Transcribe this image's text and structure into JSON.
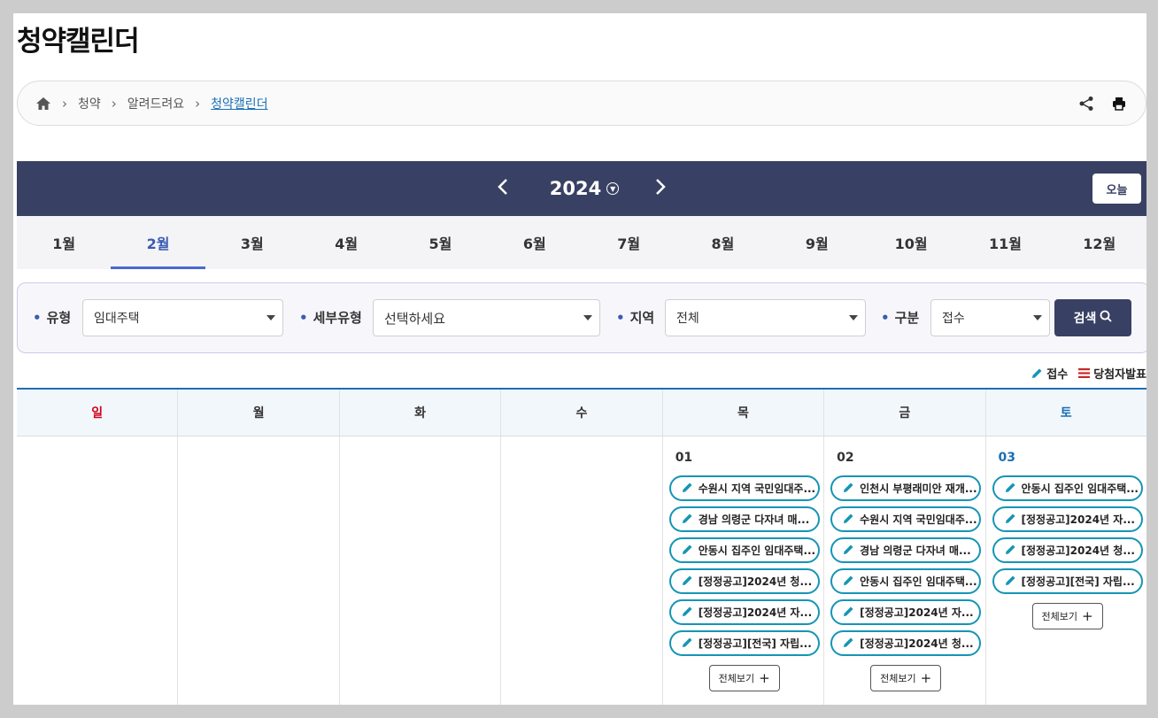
{
  "page_title": "청약캘린더",
  "breadcrumb": {
    "items": [
      "청약",
      "알려드려요"
    ],
    "current": "청약캘린더"
  },
  "year_nav": {
    "year": "2024",
    "today_label": "오늘"
  },
  "months": [
    "1월",
    "2월",
    "3월",
    "4월",
    "5월",
    "6월",
    "7월",
    "8월",
    "9월",
    "10월",
    "11월",
    "12월"
  ],
  "active_month_index": 1,
  "filter": {
    "type_label": "유형",
    "type_value": "임대주택",
    "subtype_label": "세부유형",
    "subtype_value": "선택하세요",
    "region_label": "지역",
    "region_value": "전체",
    "category_label": "구분",
    "category_value": "접수",
    "search_label": "검색"
  },
  "legend": {
    "apply_label": "접수",
    "winner_label": "당첨자발표"
  },
  "weekdays": [
    "일",
    "월",
    "화",
    "수",
    "목",
    "금",
    "토"
  ],
  "days": [
    {
      "num": "01",
      "events": [
        "수원시 지역 국민임대주...",
        "경남 의령군 다자녀 매...",
        "안동시 집주인 임대주택...",
        "[정정공고]2024년 청...",
        "[정정공고]2024년 자...",
        "[정정공고][전국] 자립..."
      ],
      "more_label": "전체보기"
    },
    {
      "num": "02",
      "events": [
        "인천시 부평래미안 재개...",
        "수원시 지역 국민임대주...",
        "경남 의령군 다자녀 매...",
        "안동시 집주인 임대주택...",
        "[정정공고]2024년 자...",
        "[정정공고]2024년 청..."
      ],
      "more_label": "전체보기"
    },
    {
      "num": "03",
      "events": [
        "안동시 집주인 임대주택...",
        "[정정공고]2024년 자...",
        "[정정공고]2024년 청...",
        "[정정공고][전국] 자립..."
      ],
      "more_label": "전체보기"
    }
  ],
  "colors": {
    "header_bg": "#384163",
    "accent": "#3b5bb5",
    "event_border": "#1595b5",
    "sunday": "#d0021b",
    "saturday": "#1a6fb5"
  }
}
